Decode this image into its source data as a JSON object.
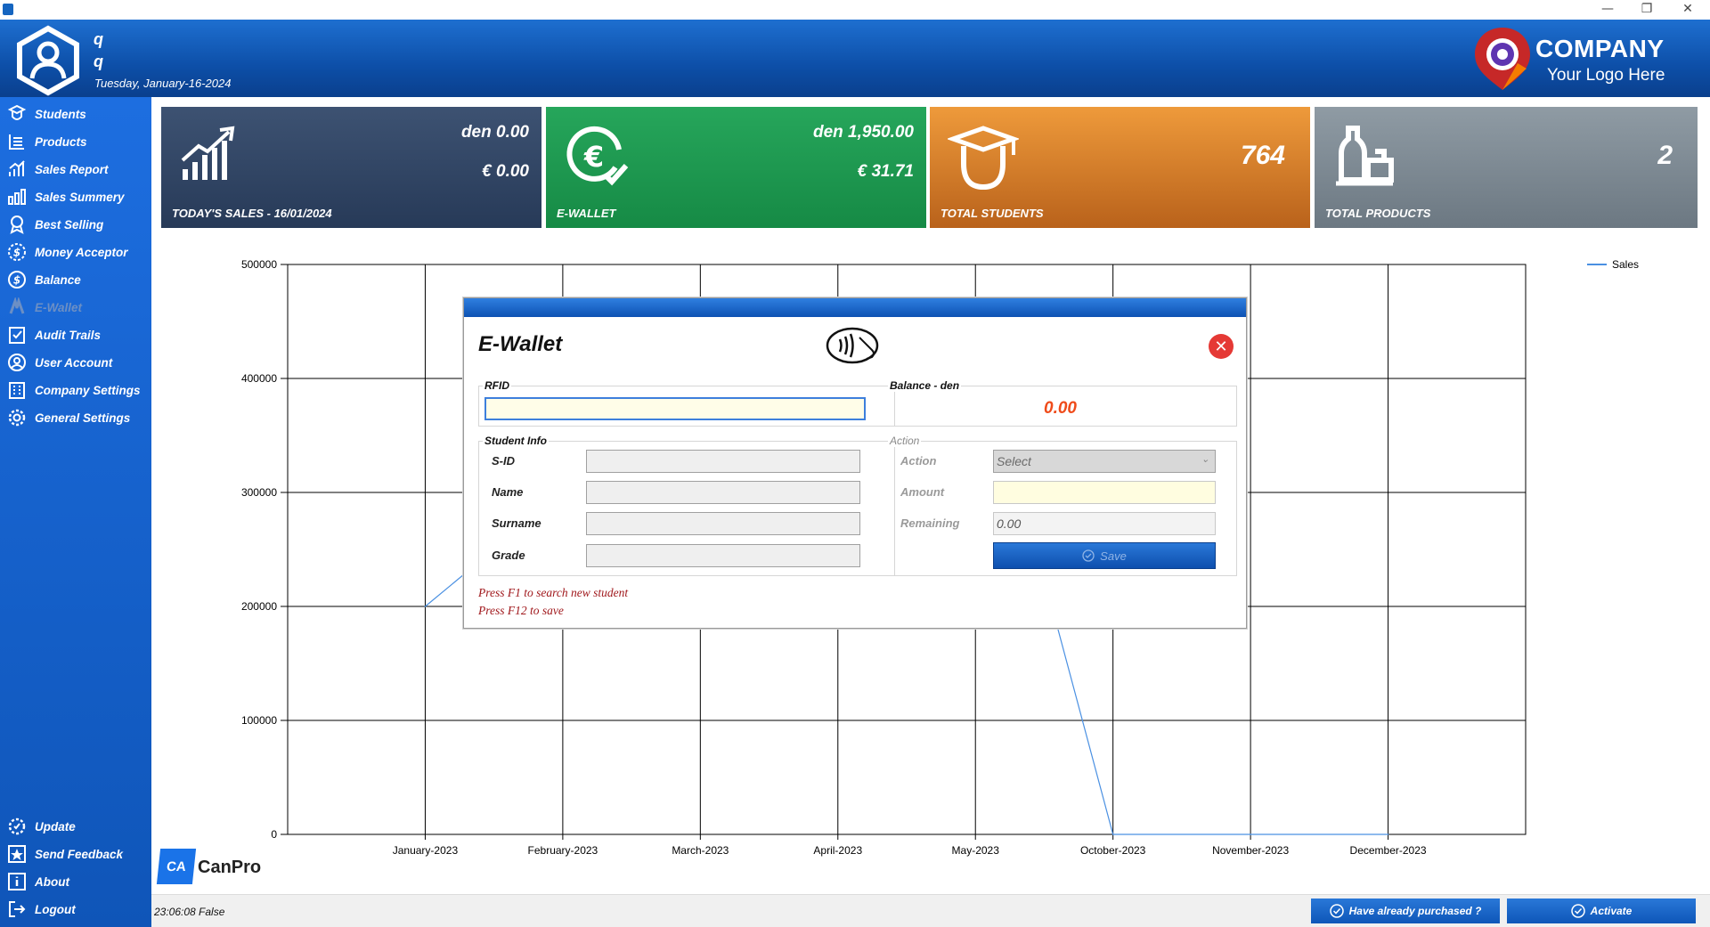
{
  "window": {
    "minimize": "—",
    "restore": "❐",
    "close": "✕"
  },
  "header": {
    "user_line1": "q",
    "user_line2": "q",
    "date": "Tuesday, January-16-2024",
    "logo_title": "COMPANY",
    "logo_subtitle": "Your Logo Here"
  },
  "sidebar": {
    "items": [
      {
        "label": "Students",
        "icon": "student-icon"
      },
      {
        "label": "Products",
        "icon": "products-icon"
      },
      {
        "label": "Sales Report",
        "icon": "sales-report-icon"
      },
      {
        "label": "Sales Summery",
        "icon": "bar-chart-icon"
      },
      {
        "label": "Best Selling",
        "icon": "award-icon"
      },
      {
        "label": "Money Acceptor",
        "icon": "dollar-icon"
      },
      {
        "label": "Balance",
        "icon": "dollar-circle-icon"
      },
      {
        "label": "E-Wallet",
        "icon": "wifi-icon",
        "disabled": true
      },
      {
        "label": "Audit Trails",
        "icon": "checklist-icon"
      },
      {
        "label": "User Account",
        "icon": "user-icon"
      },
      {
        "label": "Company Settings",
        "icon": "building-icon"
      },
      {
        "label": "General Settings",
        "icon": "gear-icon"
      }
    ],
    "bottom_items": [
      {
        "label": "Update",
        "icon": "update-icon"
      },
      {
        "label": "Send Feedback",
        "icon": "star-icon"
      },
      {
        "label": "About",
        "icon": "info-icon"
      },
      {
        "label": "Logout",
        "icon": "logout-icon"
      }
    ],
    "brand": {
      "mark": "CA",
      "name": "CanPro"
    }
  },
  "tiles": {
    "todays_sales": {
      "den": "den 0.00",
      "eur": "€ 0.00",
      "label": "TODAY'S SALES - 16/01/2024"
    },
    "ewallet": {
      "den": "den 1,950.00",
      "eur": "€ 31.71",
      "label": "E-WALLET"
    },
    "students": {
      "value": "764",
      "label": "TOTAL STUDENTS"
    },
    "products": {
      "value": "2",
      "label": "TOTAL PRODUCTS"
    }
  },
  "chart_data": {
    "type": "line",
    "categories": [
      "January-2023",
      "February-2023",
      "March-2023",
      "April-2023",
      "May-2023",
      "October-2023",
      "November-2023",
      "December-2023"
    ],
    "series": [
      {
        "name": "Sales",
        "values": [
          200000,
          300000,
          420000,
          450000,
          450000,
          0,
          0,
          0
        ],
        "color": "#4a90e2"
      }
    ],
    "yticks": [
      "500000",
      "400000",
      "300000",
      "200000",
      "100000",
      "0"
    ],
    "ylim": [
      0,
      500000
    ],
    "grid": true,
    "legend": "top-right"
  },
  "dialog": {
    "title": "E-Wallet",
    "rfid_label": "RFID",
    "rfid_value": "",
    "balance_label": "Balance  -  den",
    "balance_value": "0.00",
    "student_info_label": "Student Info",
    "fields": {
      "sid": "S-ID",
      "name": "Name",
      "surname": "Surname",
      "grade": "Grade"
    },
    "action_group_label": "Action",
    "action_label": "Action",
    "action_select": "Select",
    "amount_label": "Amount",
    "amount_value": "",
    "remaining_label": "Remaining",
    "remaining_value": "0.00",
    "save_label": "Save",
    "hint1": "Press F1 to search new student",
    "hint2": "Press F12 to save"
  },
  "statusbar": {
    "text": "23:06:08  False",
    "purchased_label": "Have already purchased ?",
    "activate_label": "Activate"
  }
}
